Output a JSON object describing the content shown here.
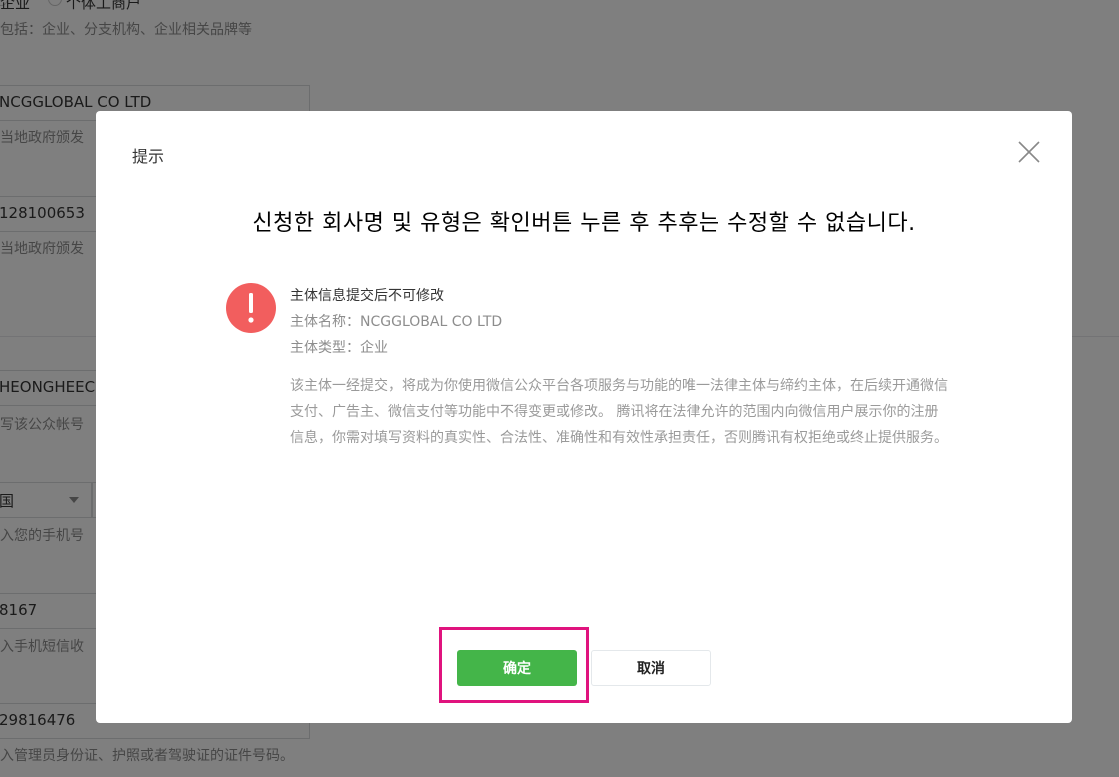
{
  "background": {
    "radio_option_1": "企业",
    "radio_option_2": "个体工商户",
    "subject_hint": "包括：企业、分支机构、企业相关品牌等",
    "company_name_value": "NCGGLOBAL CO LTD",
    "company_name_hint": "当地政府颁发",
    "license_number_value": "128100653",
    "license_number_hint": "当地政府颁发",
    "admin_name_value": "HEONGHEECH",
    "admin_name_hint": "写该公众帐号",
    "country_select_value": "国",
    "phone_hint": "入您的手机号",
    "sms_code_value": "8167",
    "sms_code_hint": "入手机短信收",
    "id_number_value": "29816476",
    "id_number_hint": "入管理员身份证、护照或者驾驶证的证件号码。"
  },
  "dialog": {
    "title": "提示",
    "close_icon": "close-icon",
    "overlay_note": "신청한 회사명 및 유형은 확인버튼 누른 후 추후는 수정할 수 없습니다.",
    "warning_icon": "exclamation-icon",
    "warning_color": "#f25e5e",
    "info_title": "主体信息提交后不可修改",
    "subject_name_label": "主体名称：",
    "subject_name_value": "NCGGLOBAL CO LTD",
    "subject_type_label": "主体类型：",
    "subject_type_value": "企业",
    "description": "该主体一经提交，将成为你使用微信公众平台各项服务与功能的唯一法律主体与缔约主体，在后续开通微信支付、广告主、微信支付等功能中不得变更或修改。 腾讯将在法律允许的范围内向微信用户展示你的注册信息，你需对填写资料的真实性、合法性、准确性和有效性承担责任，否则腾讯有权拒绝或终止提供服务。",
    "confirm_label": "确定",
    "cancel_label": "取消",
    "confirm_color": "#44b549",
    "highlight_color": "#e0137e"
  }
}
